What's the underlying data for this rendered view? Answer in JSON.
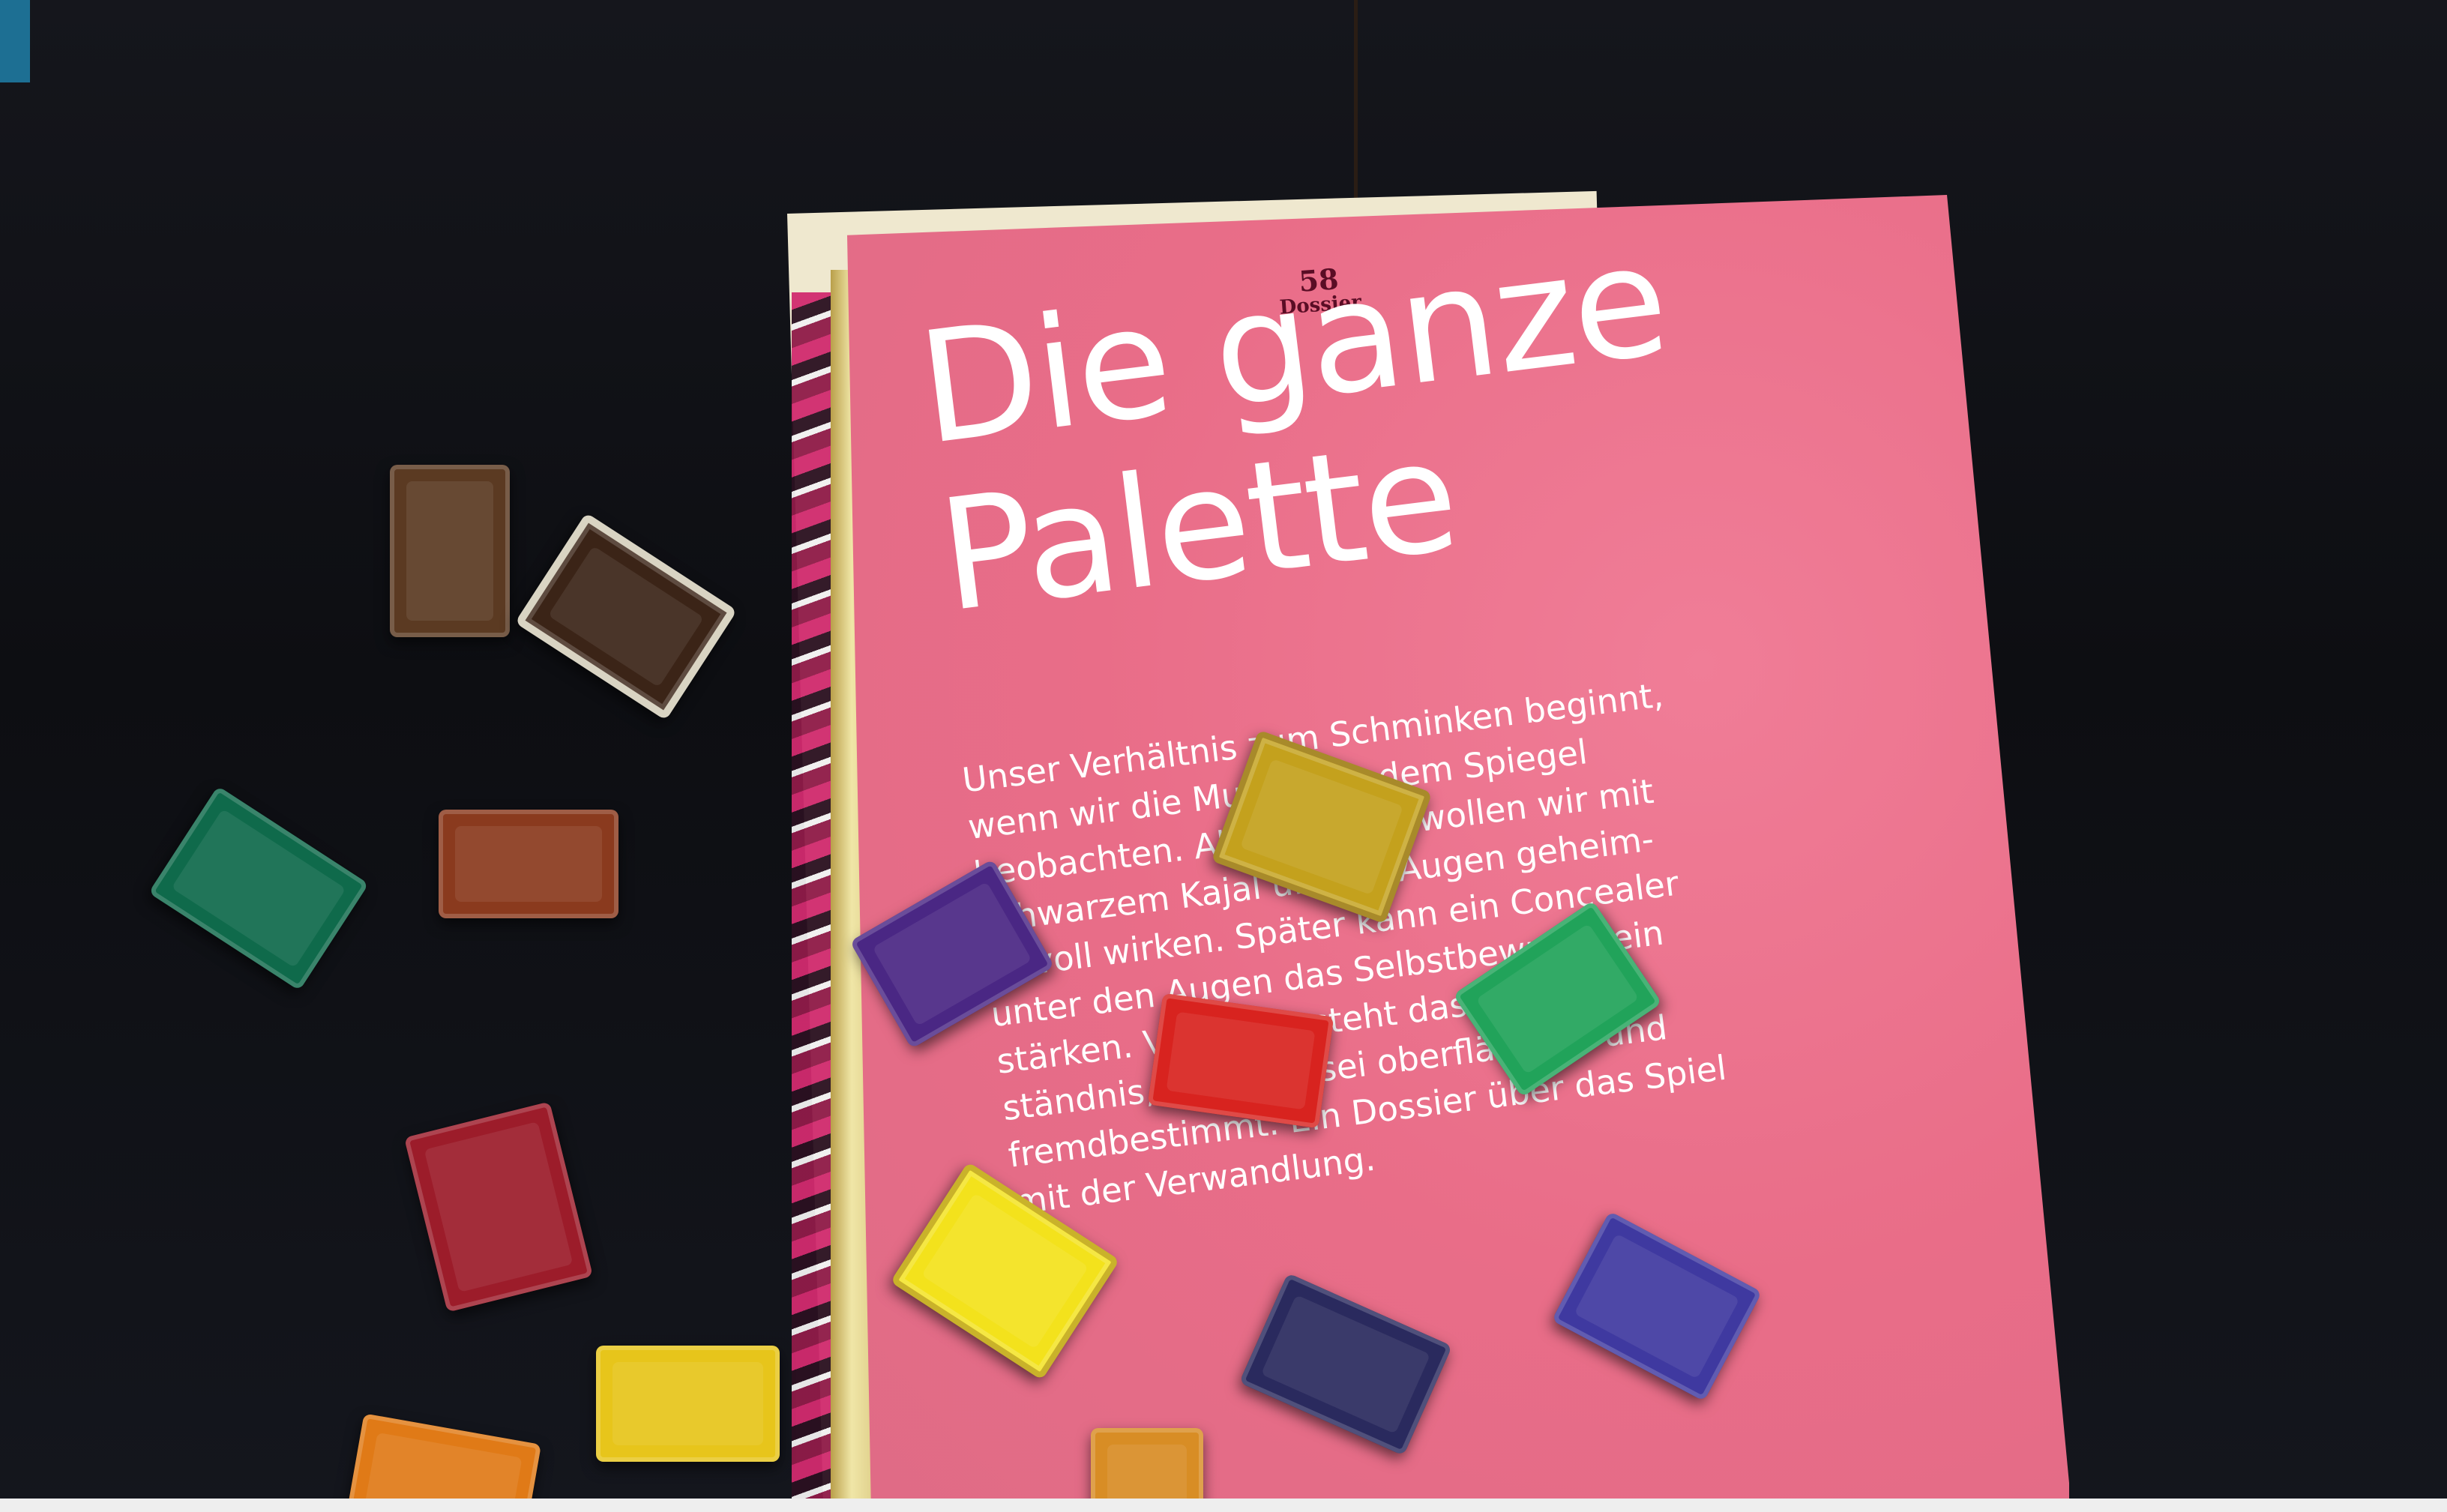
{
  "magazine": {
    "page_number": "58",
    "section": "Dossier",
    "headline": [
      "Die ganze",
      "Palette"
    ],
    "body_lines": [
      "Unser Verhältnis zum Schminken beginnt,",
      "wenn wir die Mutter vor dem Spiegel",
      "beobachten. Als Teenager wollen wir mit",
      "schwarzem Kajal um die Augen geheim-",
      "nisvoll wirken. Später kann ein Concealer",
      "unter den Augen das Selbstbewusstsein",
      "stärken. Vor allem steht das Missver-",
      "ständnis, Make-up sei oberflächlich und",
      "fremdbestimmt. Ein Dossier über das Spiel",
      "mit der Verwandlung."
    ]
  },
  "paint_pans": [
    {
      "color": "brown",
      "hex": "#5b3a22"
    },
    {
      "color": "dark-brown",
      "hex": "#3b2417"
    },
    {
      "color": "green",
      "hex": "#0f6a4b"
    },
    {
      "color": "sienna",
      "hex": "#8a3a1e"
    },
    {
      "color": "crimson",
      "hex": "#9c1c2a"
    },
    {
      "color": "yellow",
      "hex": "#e7c51b"
    },
    {
      "color": "orange",
      "hex": "#e07a17"
    },
    {
      "color": "ochre",
      "hex": "#c4a11d"
    },
    {
      "color": "purple",
      "hex": "#4a2784"
    },
    {
      "color": "bright-green",
      "hex": "#21a35a"
    },
    {
      "color": "red",
      "hex": "#d8231f"
    },
    {
      "color": "lemon-yellow",
      "hex": "#f3e21c"
    },
    {
      "color": "indigo",
      "hex": "#2a2a5e"
    },
    {
      "color": "violet",
      "hex": "#3f39a0"
    },
    {
      "color": "amber",
      "hex": "#d88d25"
    }
  ]
}
